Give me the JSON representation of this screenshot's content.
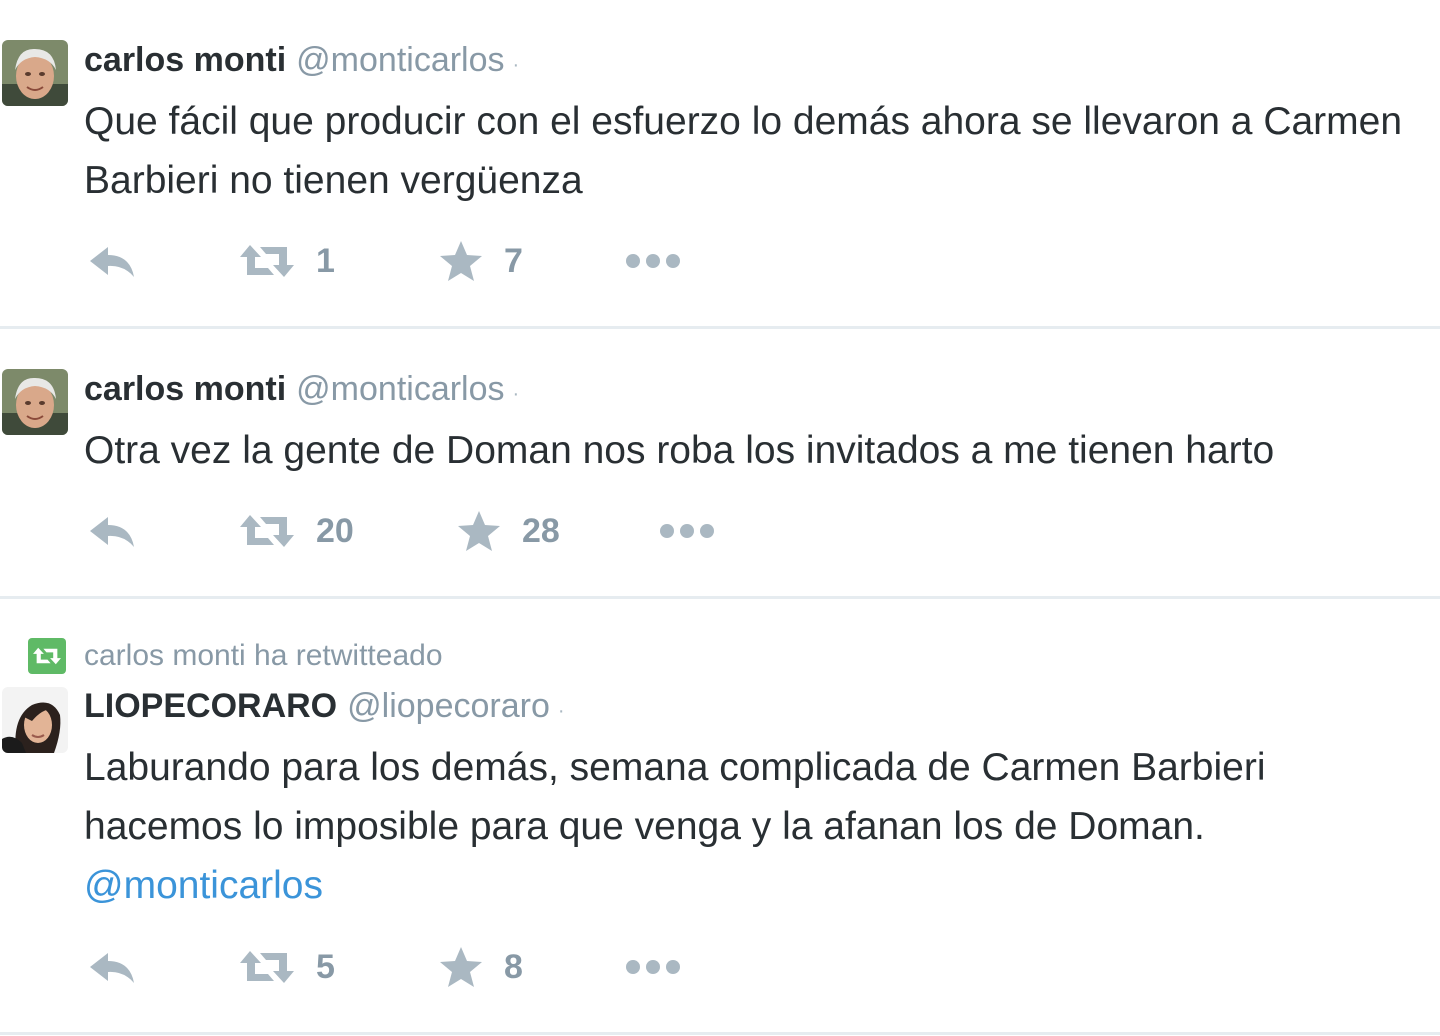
{
  "tweets": [
    {
      "fullname": "carlos monti",
      "username": "@monticarlos",
      "dot": "·",
      "text": "Que fácil que producir con el esfuerzo lo demás ahora se llevaron a Carmen Barbieri no tienen vergüenza",
      "retweets": "1",
      "favorites": "7",
      "avatar_icon": "man-portrait-avatar"
    },
    {
      "fullname": "carlos monti",
      "username": "@monticarlos",
      "dot": "·",
      "text": "Otra vez la gente de Doman nos roba los invitados a me tienen harto",
      "retweets": "20",
      "favorites": "28",
      "avatar_icon": "man-portrait-avatar"
    },
    {
      "retweet_context": "carlos monti ha retwitteado",
      "fullname": "LIOPECORARO",
      "username": "@liopecoraro",
      "dot": "·",
      "text": "Laburando para los demás, semana complicada de Carmen Barbieri hacemos lo imposible para que venga y la afanan los de Doman.",
      "mention": "@monticarlos",
      "retweets": "5",
      "favorites": "8",
      "avatar_icon": "woman-portrait-avatar"
    }
  ],
  "icons": {
    "reply": "reply-icon",
    "retweet": "retweet-icon",
    "favorite": "star-icon",
    "more": "more-dots-icon"
  },
  "colors": {
    "name": "#292f33",
    "muted": "#8899a6",
    "icon": "#aab8c2",
    "link": "#3b94d9",
    "retweet_badge": "#5fba66",
    "divider": "#e6ecf0"
  }
}
